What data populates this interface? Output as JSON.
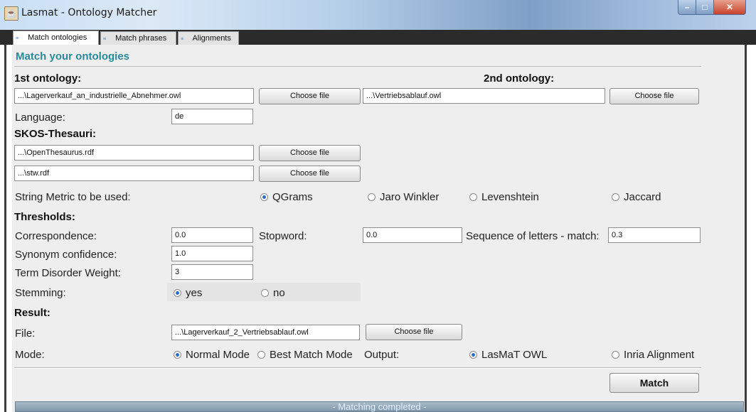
{
  "window": {
    "title": "Lasmat - Ontology Matcher",
    "app_icon": "app-icon",
    "controls": [
      "minimize-icon",
      "maximize-icon",
      "close-icon"
    ]
  },
  "tabs": [
    {
      "label": "Match ontologies",
      "icon": "ontology-icon",
      "active": true
    },
    {
      "label": "Match phrases",
      "icon": "ontology-icon",
      "active": false
    },
    {
      "label": "Alignments",
      "icon": "ontology-icon",
      "active": false
    }
  ],
  "main": {
    "heading": "Match your ontologies",
    "ontology1": {
      "label": "1st ontology:",
      "value": "...\\Lagerverkauf_an_industrielle_Abnehmer.owl",
      "button": "Choose file"
    },
    "ontology2": {
      "label": "2nd ontology:",
      "value": "...\\Vertriebsablauf.owl",
      "button": "Choose file"
    },
    "language": {
      "label": "Language:",
      "value": "de"
    },
    "skos": {
      "label": "SKOS-Thesauri:",
      "items": [
        {
          "value": "...\\OpenThesaurus.rdf",
          "button": "Choose file"
        },
        {
          "value": "...\\stw.rdf",
          "button": "Choose file"
        }
      ]
    },
    "metric": {
      "label": "String Metric to be used:",
      "options": [
        {
          "label": "QGrams",
          "selected": true
        },
        {
          "label": "Jaro Winkler",
          "selected": false
        },
        {
          "label": "Levenshtein",
          "selected": false
        },
        {
          "label": "Jaccard",
          "selected": false
        }
      ]
    },
    "thresholds": {
      "label": "Thresholds:",
      "correspondence": {
        "label": "Correspondence:",
        "value": "0.0"
      },
      "stopword": {
        "label": "Stopword:",
        "value": "0.0"
      },
      "sequence": {
        "label": "Sequence of letters - match:",
        "value": "0.3"
      },
      "synonym": {
        "label": "Synonym confidence:",
        "value": "1.0"
      },
      "disorder": {
        "label": "Term Disorder Weight:",
        "value": "3"
      }
    },
    "stemming": {
      "label": "Stemming:",
      "options": [
        {
          "label": "yes",
          "selected": true
        },
        {
          "label": "no",
          "selected": false
        }
      ]
    },
    "result": {
      "label": "Result:",
      "file_label": "File:",
      "file_value": "...\\Lagerverkauf_2_Vertriebsablauf.owl",
      "button": "Choose file",
      "mode_label": "Mode:",
      "mode_options": [
        {
          "label": "Normal Mode",
          "selected": true
        },
        {
          "label": "Best Match Mode",
          "selected": false
        }
      ],
      "output_label": "Output:",
      "output_options": [
        {
          "label": "LasMaT OWL",
          "selected": true
        },
        {
          "label": "Inria Alignment",
          "selected": false
        }
      ]
    },
    "match_button": "Match",
    "status": "- Matching completed -"
  }
}
